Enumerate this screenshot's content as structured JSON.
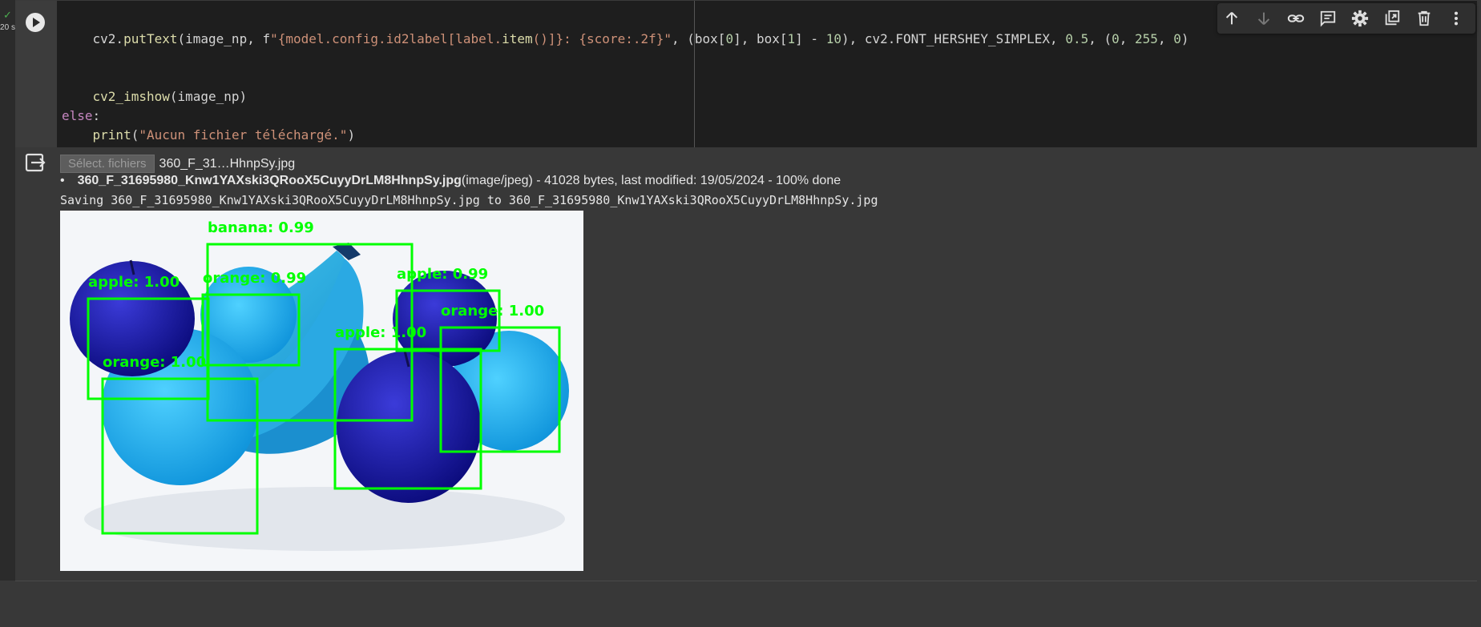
{
  "cell": {
    "status_check": "✓",
    "exec_time": "20 s",
    "code_lines": [
      "    cv2.putText(image_np, f\"{model.config.id2label[label.item()]}: {score:.2f}\", (box[0], box[1] - 10), cv2.FONT_HERSHEY_SIMPLEX, 0.5, (0, 255, 0)",
      "",
      "",
      "    cv2_imshow(image_np)",
      "else:",
      "    print(\"Aucun fichier téléchargé.\")"
    ]
  },
  "toolbar": {
    "icons": [
      "arrow-up-icon",
      "arrow-down-icon",
      "link-icon",
      "comment-icon",
      "gear-icon",
      "mirror-cell-icon",
      "delete-icon",
      "more-vert-icon"
    ]
  },
  "output": {
    "file_button_label": "Sélect. fichiers",
    "selected_file": "360_F_31…HhnpSy.jpg",
    "uploaded_file_name": "360_F_31695980_Knw1YAXski3QRooX5CuyyDrLM8HhnpSy.jpg",
    "uploaded_file_meta": "(image/jpeg) - 41028 bytes, last modified: 19/05/2024 - 100% done",
    "saving_line": "Saving 360_F_31695980_Knw1YAXski3QRooX5CuyyDrLM8HhnpSy.jpg to 360_F_31695980_Knw1YAXski3QRooX5CuyyDrLM8HhnpSy.jpg",
    "detections": [
      {
        "label": "banana: 0.99"
      },
      {
        "label": "apple: 1.00"
      },
      {
        "label": "orange: 0.99"
      },
      {
        "label": "apple: 0.99"
      },
      {
        "label": "orange: 1.00"
      },
      {
        "label": "apple: 1.00"
      },
      {
        "label": "orange: 1.00"
      }
    ],
    "box_color": "#00ff00"
  }
}
